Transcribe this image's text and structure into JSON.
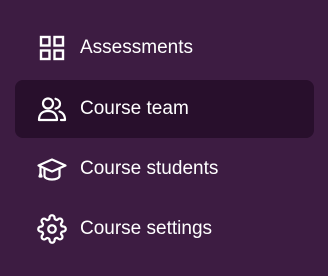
{
  "sidebar": {
    "items": [
      {
        "label": "Assessments",
        "icon": "grid-icon",
        "active": false
      },
      {
        "label": "Course team",
        "icon": "users-icon",
        "active": true
      },
      {
        "label": "Course students",
        "icon": "graduation-cap-icon",
        "active": false
      },
      {
        "label": "Course settings",
        "icon": "gear-icon",
        "active": false
      }
    ]
  },
  "colors": {
    "background": "#3d1c42",
    "active_background": "#280f2c",
    "text": "#ffffff"
  }
}
